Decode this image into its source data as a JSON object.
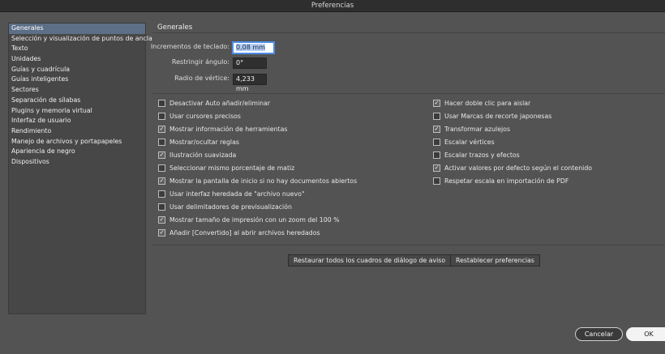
{
  "window": {
    "title": "Preferencias"
  },
  "sidebar": {
    "items": [
      {
        "label": "Generales",
        "selected": true
      },
      {
        "label": "Selección y visualización de puntos de ancla"
      },
      {
        "label": "Texto"
      },
      {
        "label": "Unidades"
      },
      {
        "label": "Guías y cuadrícula"
      },
      {
        "label": "Guías inteligentes"
      },
      {
        "label": "Sectores"
      },
      {
        "label": "Separación de sílabas"
      },
      {
        "label": "Plugins y memoria virtual"
      },
      {
        "label": "Interfaz de usuario"
      },
      {
        "label": "Rendimiento"
      },
      {
        "label": "Manejo de archivos y portapapeles"
      },
      {
        "label": "Apariencia de negro"
      },
      {
        "label": "Dispositivos"
      }
    ]
  },
  "section": {
    "title": "Generales"
  },
  "fields": {
    "keyboard_increment": {
      "label": "Incrementos de teclado:",
      "value": "0,08 mm"
    },
    "constrain_angle": {
      "label": "Restringir ángulo:",
      "value": "0°"
    },
    "corner_radius": {
      "label": "Radio de vértice:",
      "value": "4,233 mm"
    }
  },
  "checkboxes_left": [
    {
      "label": "Desactivar Auto añadir/eliminar",
      "checked": false
    },
    {
      "label": "Usar cursores precisos",
      "checked": false
    },
    {
      "label": "Mostrar información de herramientas",
      "checked": true
    },
    {
      "label": "Mostrar/ocultar reglas",
      "checked": false
    },
    {
      "label": "Ilustración suavizada",
      "checked": true
    },
    {
      "label": "Seleccionar mismo porcentaje de matiz",
      "checked": false
    },
    {
      "label": "Mostrar la pantalla de inicio si no hay documentos abiertos",
      "checked": true
    },
    {
      "label": "Usar interfaz heredada de \"archivo nuevo\"",
      "checked": false
    },
    {
      "label": "Usar delimitadores de previsualización",
      "checked": false
    },
    {
      "label": "Mostrar tamaño de impresión con un zoom del 100 %",
      "checked": true
    },
    {
      "label": "Añadir [Convertido] al abrir archivos heredados",
      "checked": true
    }
  ],
  "checkboxes_right": [
    {
      "label": "Hacer doble clic para aislar",
      "checked": true
    },
    {
      "label": "Usar Marcas de recorte japonesas",
      "checked": false
    },
    {
      "label": "Transformar azulejos",
      "checked": true
    },
    {
      "label": "Escalar vértices",
      "checked": false
    },
    {
      "label": "Escalar trazos y efectos",
      "checked": false
    },
    {
      "label": "Activar valores por defecto según el contenido",
      "checked": true
    },
    {
      "label": "Respetar escala en importación de PDF",
      "checked": false
    }
  ],
  "buttons": {
    "reset_dialogs": "Restaurar todos los cuadros de diálogo de aviso",
    "reset_prefs": "Restablecer preferencias",
    "cancel": "Cancelar",
    "ok": "OK"
  },
  "check_glyph": "✓"
}
